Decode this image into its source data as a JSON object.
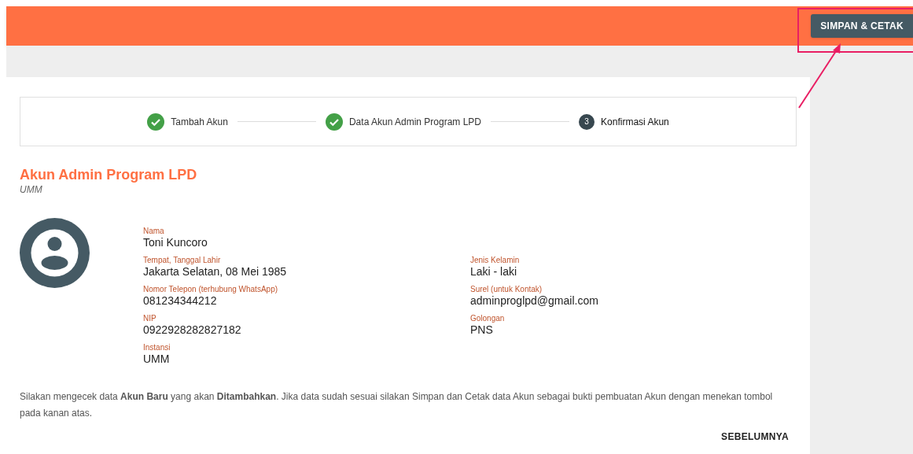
{
  "header": {
    "button": "SIMPAN & CETAK"
  },
  "stepper": [
    {
      "label": "Tambah Akun",
      "completed": true
    },
    {
      "label": "Data Akun Admin Program LPD",
      "completed": true
    },
    {
      "label": "Konfirmasi Akun",
      "completed": false,
      "number": "3"
    }
  ],
  "title": "Akun Admin Program LPD",
  "subtitle": "UMM",
  "fields_left": [
    {
      "label": "Nama",
      "value": "Toni Kuncoro"
    },
    {
      "label": "Tempat, Tanggal Lahir",
      "value": "Jakarta Selatan, 08 Mei 1985"
    },
    {
      "label": "Nomor Telepon (terhubung WhatsApp)",
      "value": "081234344212"
    },
    {
      "label": "NIP",
      "value": "0922928282827182"
    },
    {
      "label": "Instansi",
      "value": "UMM"
    }
  ],
  "fields_right": [
    {
      "label": "Jenis Kelamin",
      "value": "Laki - laki"
    },
    {
      "label": "Surel (untuk Kontak)",
      "value": "adminproglpd@gmail.com"
    },
    {
      "label": "Golongan",
      "value": "PNS"
    }
  ],
  "note": "Silakan mengecek data **Akun Baru** yang akan **Ditambahkan**. Jika data sudah sesuai silakan Simpan dan Cetak data Akun sebagai bukti pembuatan Akun dengan menekan tombol pada kanan atas.",
  "back_button": "SEBELUMNYA"
}
